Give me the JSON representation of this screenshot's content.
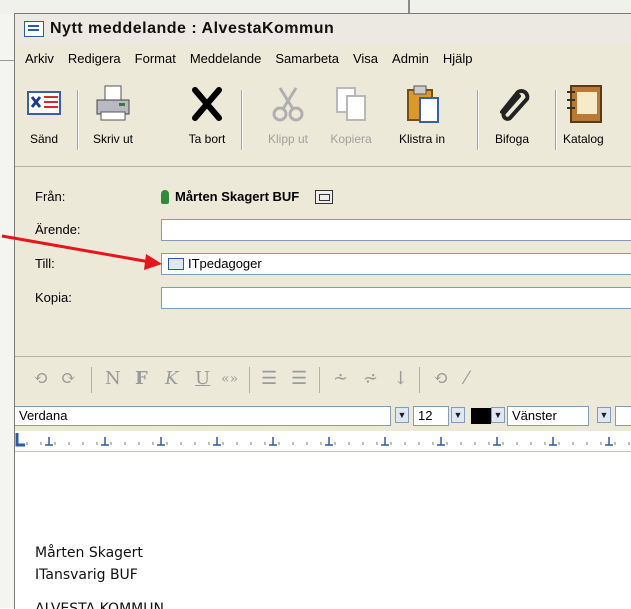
{
  "window": {
    "title": "Nytt meddelande : AlvestaKommun"
  },
  "menu": [
    "Arkiv",
    "Redigera",
    "Format",
    "Meddelande",
    "Samarbeta",
    "Visa",
    "Admin",
    "Hjälp"
  ],
  "toolbar": {
    "send": "Sänd",
    "print": "Skriv ut",
    "delete": "Ta bort",
    "cut": "Klipp ut",
    "copy": "Kopiera",
    "paste": "Klistra in",
    "attach": "Bifoga",
    "catalog": "Katalog"
  },
  "header": {
    "from_label": "Från:",
    "from_value": "Mårten Skagert BUF",
    "subject_label": "Ärende:",
    "subject_value": "",
    "to_label": "Till:",
    "to_value": "ITpedagoger",
    "cc_label": "Kopia:",
    "cc_value": ""
  },
  "format_toolbar": {
    "font": "Verdana",
    "size": "12",
    "align": "Vänster",
    "text_color": "#000000"
  },
  "body": {
    "line1": "Mårten Skagert",
    "line2": "ITansvarig BUF",
    "line3": "ALVESTA KOMMUN"
  },
  "annotation": {
    "arrow_color": "#e8141c"
  }
}
